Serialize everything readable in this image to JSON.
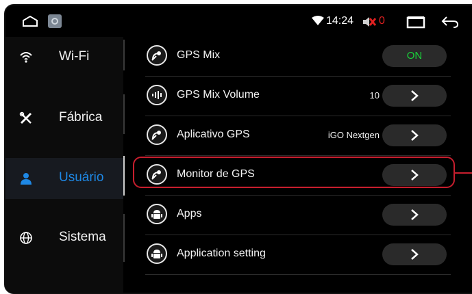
{
  "statusbar": {
    "time": "14:24",
    "notif_count": "0"
  },
  "sidebar": {
    "items": [
      {
        "label": "Wi-Fi",
        "icon": "wifi-icon"
      },
      {
        "label": "Fábrica",
        "icon": "tools-icon"
      },
      {
        "label": "Usuário",
        "icon": "user-icon",
        "active": true
      },
      {
        "label": "Sistema",
        "icon": "globe-icon"
      }
    ]
  },
  "settings": {
    "rows": [
      {
        "label": "GPS Mix",
        "value": "",
        "control": "ON",
        "icon": "satellite-icon"
      },
      {
        "label": "GPS Mix Volume",
        "value": "10",
        "icon": "volume-icon"
      },
      {
        "label": "Aplicativo GPS",
        "value": "iGO Nextgen",
        "icon": "satellite-icon"
      },
      {
        "label": "Monitor de GPS",
        "value": "",
        "icon": "satellite-icon",
        "highlighted": true
      },
      {
        "label": "Apps",
        "value": "",
        "icon": "android-icon"
      },
      {
        "label": "Application setting",
        "value": "",
        "icon": "android-icon"
      }
    ]
  },
  "colors": {
    "accent": "#1e88e5",
    "toggle_on": "#19d13a",
    "highlight": "#c81e2e",
    "mute": "#e02020"
  }
}
